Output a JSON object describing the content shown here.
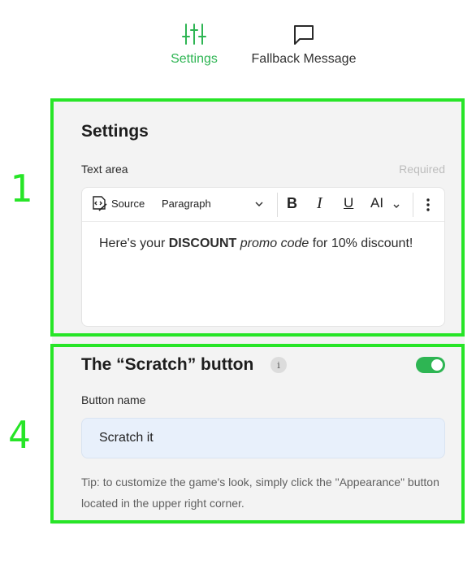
{
  "tabs": [
    {
      "label": "Settings",
      "icon": "sliders-icon",
      "active": true
    },
    {
      "label": "Fallback Message",
      "icon": "message-icon",
      "active": false
    }
  ],
  "colors": {
    "accent": "#2eb553",
    "highlight": "#27e527",
    "panel": "#f3f3f3",
    "input_bg": "#e8f0fb"
  },
  "annotations": {
    "step_1": "1",
    "step_4": "4"
  },
  "settings": {
    "title": "Settings",
    "text_area_label": "Text area",
    "required": "Required",
    "toolbar": {
      "source": "Source",
      "paragraph": "Paragraph",
      "bold": "B",
      "italic": "I",
      "underline": "U",
      "font_size": "AI"
    },
    "content": {
      "part1": "Here's your ",
      "bold": "DISCOUNT",
      "part2": " ",
      "italic": "promo code",
      "part3": " for 10% discount!"
    }
  },
  "scratch": {
    "title": "The “Scratch” button",
    "info": "i",
    "toggle_on": true,
    "button_name_label": "Button name",
    "button_name_value": "Scratch it",
    "tip": "Tip: to customize the game's look, simply click the \"Appearance\" button located in the upper right corner."
  }
}
